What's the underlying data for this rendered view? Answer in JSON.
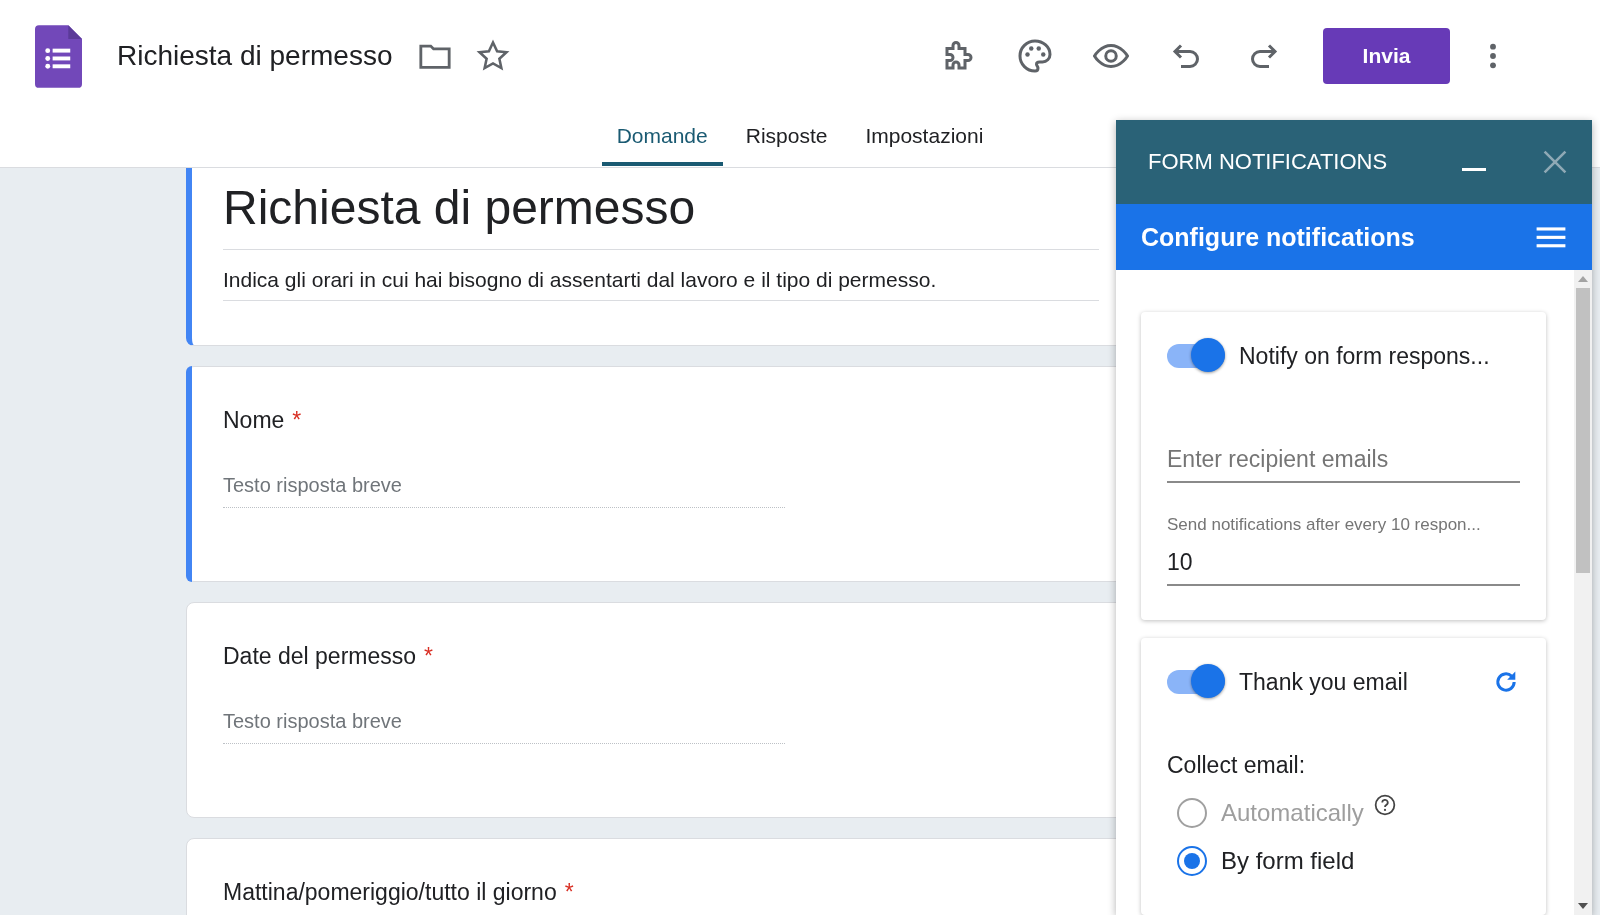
{
  "app": {
    "title": "Richiesta di permesso",
    "send_button": "Invia"
  },
  "tabs": [
    {
      "label": "Domande",
      "selected": true
    },
    {
      "label": "Risposte",
      "selected": false
    },
    {
      "label": "Impostazioni",
      "selected": false
    }
  ],
  "form": {
    "title": "Richiesta di permesso",
    "description": "Indica gli orari in cui hai bisogno di assentarti dal lavoro e il tipo di permesso."
  },
  "questions": [
    {
      "title": "Nome",
      "required_mark": "*",
      "placeholder": "Testo risposta breve",
      "active": true
    },
    {
      "title": "Date del permesso",
      "required_mark": "*",
      "placeholder": "Testo risposta breve",
      "active": false
    },
    {
      "title": "Mattina/pomeriggio/tutto il giorno",
      "required_mark": "*",
      "active": false
    }
  ],
  "panel": {
    "title": "FORM NOTIFICATIONS",
    "subtitle": "Configure notifications",
    "notify": {
      "on": true,
      "label": "Notify on form respons...",
      "recipients_placeholder": "Enter recipient emails",
      "threshold_label": "Send notifications after every 10 respon...",
      "threshold_value": "10"
    },
    "thanks": {
      "on": true,
      "label": "Thank you email",
      "collect_label": "Collect email:",
      "options": [
        {
          "label": "Automatically",
          "selected": false,
          "disabled": true
        },
        {
          "label": "By form field",
          "selected": true,
          "disabled": false
        }
      ]
    }
  }
}
